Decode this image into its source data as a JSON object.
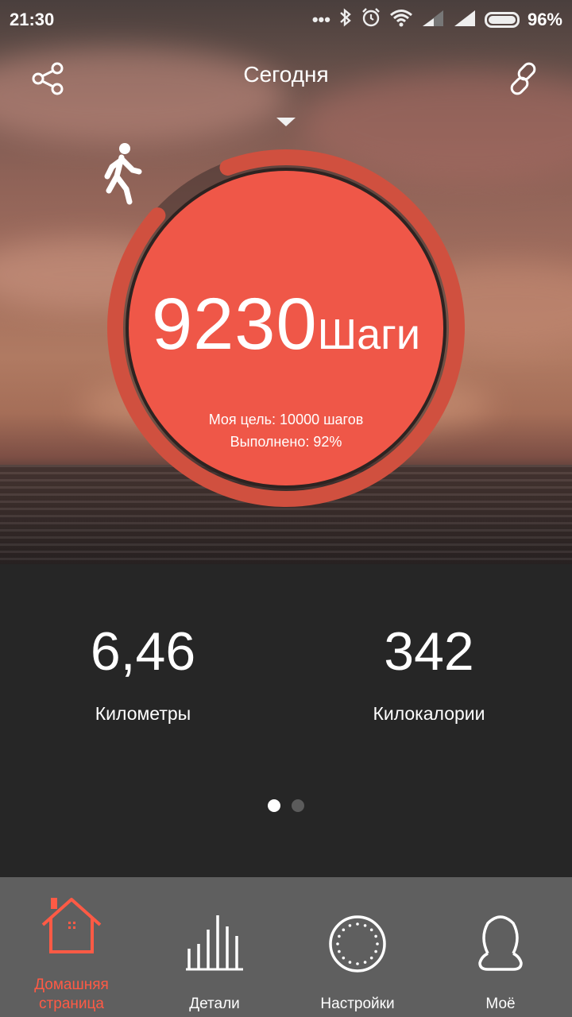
{
  "status_bar": {
    "time": "21:30",
    "battery": "96%",
    "icons": [
      "more-dots-icon",
      "bluetooth-icon",
      "alarm-icon",
      "wifi-icon",
      "signal-icon",
      "signal-icon",
      "battery-icon"
    ]
  },
  "header": {
    "title": "Сегодня",
    "share_icon": "share-icon",
    "link_icon": "link-icon",
    "dropdown_icon": "dropdown-arrow-icon"
  },
  "steps_ring": {
    "icon": "walking-icon",
    "steps": "9230",
    "unit": "Шаги",
    "goal_text": "Моя цель: 10000 шагов",
    "completed_text": "Выполнено: 92%",
    "progress": 0.92
  },
  "stats": {
    "km_value": "6,46",
    "km_label": "Километры",
    "kcal_value": "342",
    "kcal_label": "Килокалории"
  },
  "pager": {
    "count": 2,
    "active": 0
  },
  "bottom_nav": {
    "items": [
      {
        "label_line1": "Домашняя",
        "label_line2": "страница",
        "icon": "home-icon",
        "active": true
      },
      {
        "label": "Детали",
        "icon": "bar-chart-icon",
        "active": false
      },
      {
        "label": "Настройки",
        "icon": "settings-circle-icon",
        "active": false
      },
      {
        "label": "Моё",
        "icon": "profile-icon",
        "active": false
      }
    ]
  },
  "colors": {
    "accent": "#ef5748",
    "ring_track": "#4b3e3c",
    "stats_bg": "#262626",
    "nav_bg": "#5f5f5f",
    "nav_active": "#ff5a45"
  }
}
